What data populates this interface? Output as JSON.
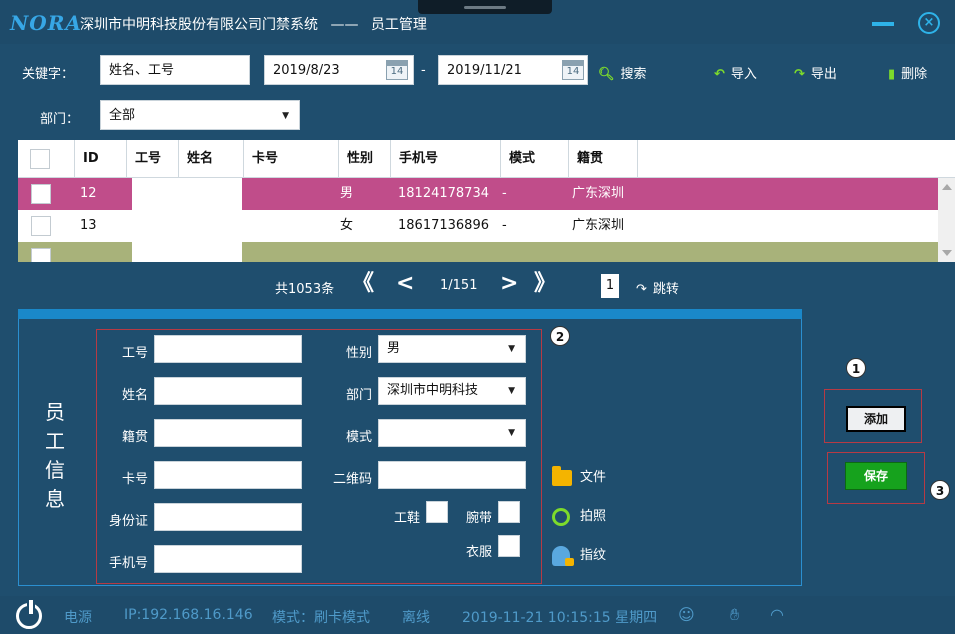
{
  "window": {
    "logo": "NORA",
    "title": "深圳市中明科技股份有限公司门禁系统",
    "separator": "——",
    "module": "员工管理",
    "close_glyph": "×"
  },
  "toolbar": {
    "keyword_label": "关键字：",
    "keyword_value": "姓名、工号",
    "date_from": "2019/8/23",
    "date_to": "2019/11/21",
    "date_sep": "-",
    "calendar_day": "14",
    "search_label": "搜索",
    "import_label": "导入",
    "export_label": "导出",
    "delete_label": "删除",
    "dept_label": "部门：",
    "dept_value": "全部"
  },
  "table": {
    "columns": [
      "ID",
      "工号",
      "姓名",
      "卡号",
      "性别",
      "手机号",
      "模式",
      "籍贯"
    ],
    "rows": [
      {
        "id": "12",
        "gender": "男",
        "phone": "18124178734",
        "mode": "-",
        "origin": "广东深圳"
      },
      {
        "id": "13",
        "gender": "女",
        "phone": "18617136896",
        "mode": "-",
        "origin": "广东深圳"
      }
    ]
  },
  "pager": {
    "total": "共1053条",
    "first": "《",
    "prev": "<",
    "current": "1/151",
    "next": ">",
    "last": "》",
    "page_input": "1",
    "jump_label": "跳转"
  },
  "form": {
    "side_title": "员工信息",
    "labels": {
      "emp_no": "工号",
      "name": "姓名",
      "origin": "籍贯",
      "card_no": "卡号",
      "id_card": "身份证",
      "phone": "手机号",
      "gender": "性别",
      "department": "部门",
      "mode": "模式",
      "qr_code": "二维码",
      "shoes": "工鞋",
      "wristband": "腕带",
      "clothes": "衣服"
    },
    "values": {
      "gender": "男",
      "department": "深圳市中明科技"
    },
    "file_label": "文件",
    "photo_label": "拍照",
    "fingerprint_label": "指纹"
  },
  "actions": {
    "add_label": "添加",
    "save_label": "保存"
  },
  "callouts": [
    "1",
    "2",
    "3"
  ],
  "statusbar": {
    "power_label": "电源",
    "ip": "IP:192.168.16.146",
    "mode": "模式：刷卡模式",
    "network": "离线",
    "datetime": "2019-11-21 10:15:15 星期四"
  },
  "colors": {
    "row_selected": "#c04d8a",
    "row_alt": "#a8b27a",
    "accent_blue": "#1a88c9",
    "save_green": "#16a21d",
    "callout_red": "#b63a44"
  }
}
